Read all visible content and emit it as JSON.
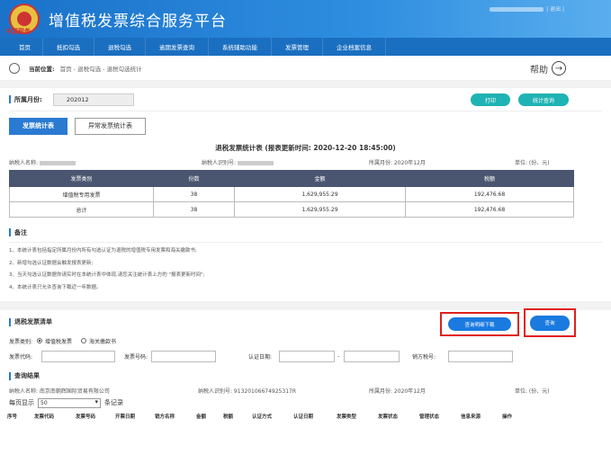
{
  "app": {
    "title": "增值税发票综合服务平台",
    "logo_text": "中国税务",
    "user_suffix": "| 退出 |"
  },
  "nav": [
    "首页",
    "抵扣勾选",
    "退税勾选",
    "逾期发票查询",
    "系统辅助功能",
    "发票管理",
    "企业档案信息"
  ],
  "breadcrumb": {
    "label": "当前位置:",
    "path": "首页 - 退税勾选 - 退税勾选统计"
  },
  "help": {
    "label": "帮助",
    "icon": "arrow-right-circle-icon"
  },
  "month": {
    "label": "所属月份:",
    "value": "202012"
  },
  "actions": {
    "print": "打印",
    "stat_query": "统计查询"
  },
  "tabs": [
    {
      "label": "发票统计表",
      "active": true
    },
    {
      "label": "异常发票统计表",
      "active": false
    }
  ],
  "stat_table": {
    "title": "退税发票统计表 (报表更新时间: 2020-12-20 18:45:00)",
    "meta": {
      "taxpayer_name_label": "纳税人名称:",
      "taxpayer_id_label": "纳税人识别号:",
      "month_label": "所属月份: 2020年12月",
      "unit": "单位: (份、元)"
    },
    "headers": [
      "发票类别",
      "份数",
      "金额",
      "税额"
    ],
    "rows": [
      [
        "增值税专用发票",
        "38",
        "1,629,955.29",
        "192,476.68"
      ],
      [
        "总计",
        "38",
        "1,629,955.29",
        "192,476.68"
      ]
    ]
  },
  "remarks": {
    "title": "备注",
    "items": [
      "1、本统计表包括指定所属月份内所有勾选认证为退税的增值税专用发票和海关缴款书;",
      "2、新增勾选认证数据会触发报表更新;",
      "3、当天勾选认证数据你请实时在本统计表中体现,请您关注统计表上方的 \"报表更新时间\";",
      "4、本统计表只允许查询下载近一年数据。"
    ]
  },
  "invoice_list": {
    "title": "退税发票清单",
    "download_btn": "查询明细下载",
    "query_btn": "查询",
    "type_label": "发票类别:",
    "type_options": [
      {
        "label": "增值税发票",
        "checked": true
      },
      {
        "label": "海关缴款书",
        "checked": false
      }
    ],
    "code_label": "发票代码:",
    "number_label": "发票号码:",
    "date_label": "认证日期:",
    "date_sep": "-",
    "seller_tax_label": "销方税号:"
  },
  "results": {
    "title": "查询结果",
    "taxpayer_name": "纳税人名称: 南京南朝辉国际贸易有限公司",
    "taxpayer_id": "纳税人识别号: 91320106674925317R",
    "month_label": "所属月份: 2020年12月",
    "unit": "单位: (份、元)",
    "per_page_prefix": "每页显示",
    "per_page_value": "50",
    "per_page_suffix": "条记录",
    "columns": [
      "序号",
      "发票代码",
      "发票号码",
      "开票日期",
      "销方名称",
      "金额",
      "税额",
      "认证方式",
      "认证日期",
      "发票类型",
      "发票状态",
      "管理状态",
      "信息来源",
      "操作"
    ]
  },
  "colors": {
    "header": "#1a72c9",
    "nav": "#1b6fc0",
    "teal": "#1fb3b3",
    "table_head": "#4a5670",
    "highlight": "#e0201a"
  }
}
